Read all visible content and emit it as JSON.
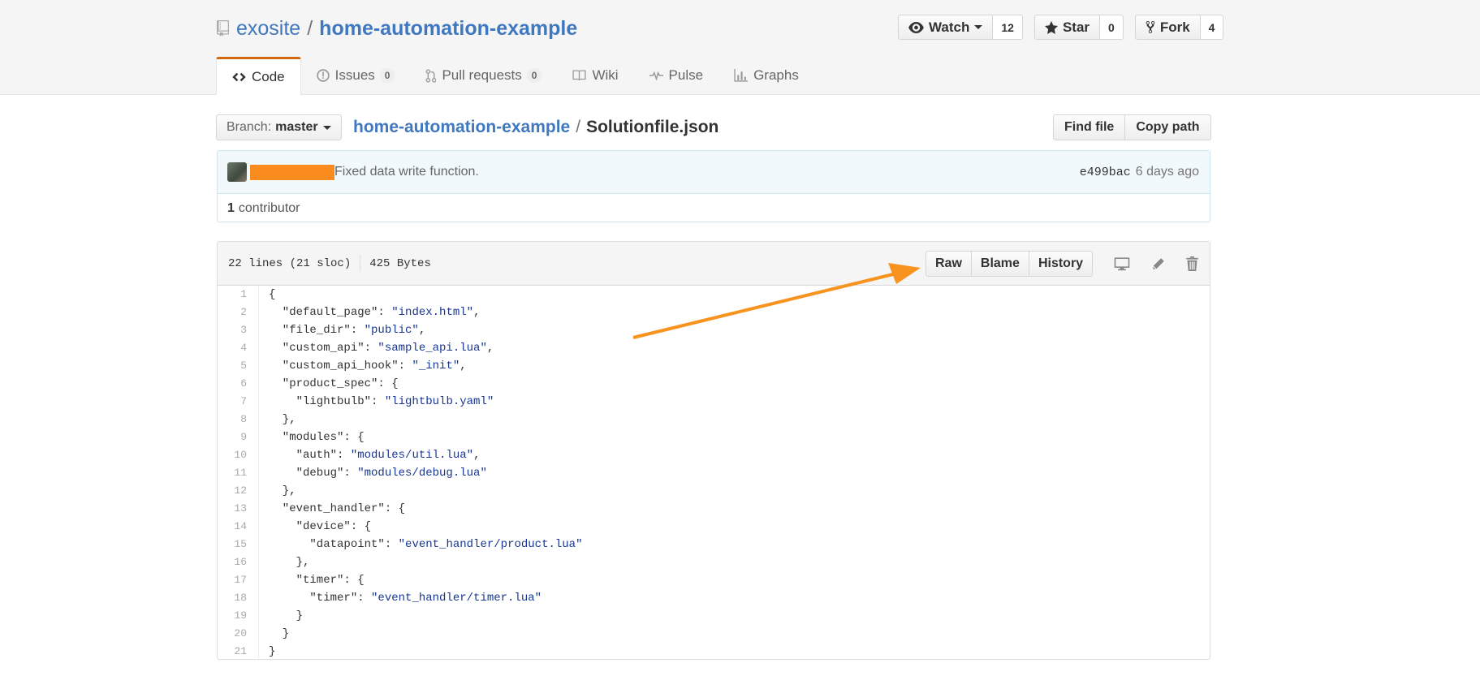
{
  "repo": {
    "owner": "exosite",
    "separator": "/",
    "name": "home-automation-example"
  },
  "actions": [
    {
      "label": "Watch",
      "count": "12",
      "icon": "eye-icon",
      "dropdown": true
    },
    {
      "label": "Star",
      "count": "0",
      "icon": "star-icon",
      "dropdown": false
    },
    {
      "label": "Fork",
      "count": "4",
      "icon": "fork-icon",
      "dropdown": false
    }
  ],
  "nav": [
    {
      "label": "Code",
      "icon": "code-icon",
      "selected": true
    },
    {
      "label": "Issues",
      "count": "0",
      "icon": "issue-icon"
    },
    {
      "label": "Pull requests",
      "count": "0",
      "icon": "pull-request-icon"
    },
    {
      "label": "Wiki",
      "icon": "book-icon"
    },
    {
      "label": "Pulse",
      "icon": "pulse-icon"
    },
    {
      "label": "Graphs",
      "icon": "graph-icon"
    }
  ],
  "branch": {
    "prefix": "Branch:",
    "name": "master"
  },
  "breadcrumb": {
    "repo": "home-automation-example",
    "separator": "/",
    "file": "Solutionfile.json"
  },
  "file_nav": {
    "find_file": "Find file",
    "copy_path": "Copy path"
  },
  "commit": {
    "message": "Fixed data write function.",
    "sha": "e499bac",
    "time": "6 days ago",
    "contributors_count": "1",
    "contributors_label": "contributor",
    "redaction_color": "#fa8c1e"
  },
  "file": {
    "lines_info": "22 lines (21 sloc)",
    "size": "425 Bytes",
    "raw": "Raw",
    "blame": "Blame",
    "history": "History"
  },
  "code_lines": [
    "{",
    "  \"default_page\": \"index.html\",",
    "  \"file_dir\": \"public\",",
    "  \"custom_api\": \"sample_api.lua\",",
    "  \"custom_api_hook\": \"_init\",",
    "  \"product_spec\": {",
    "    \"lightbulb\": \"lightbulb.yaml\"",
    "  },",
    "  \"modules\": {",
    "    \"auth\": \"modules/util.lua\",",
    "    \"debug\": \"modules/debug.lua\"",
    "  },",
    "  \"event_handler\": {",
    "    \"device\": {",
    "      \"datapoint\": \"event_handler/product.lua\"",
    "    },",
    "    \"timer\": {",
    "      \"timer\": \"event_handler/timer.lua\"",
    "    }",
    "  }",
    "}"
  ],
  "colors": {
    "link": "#4078c0",
    "nav_accent": "#d26911",
    "annotation_arrow": "#f7931e",
    "string": "#183691"
  }
}
